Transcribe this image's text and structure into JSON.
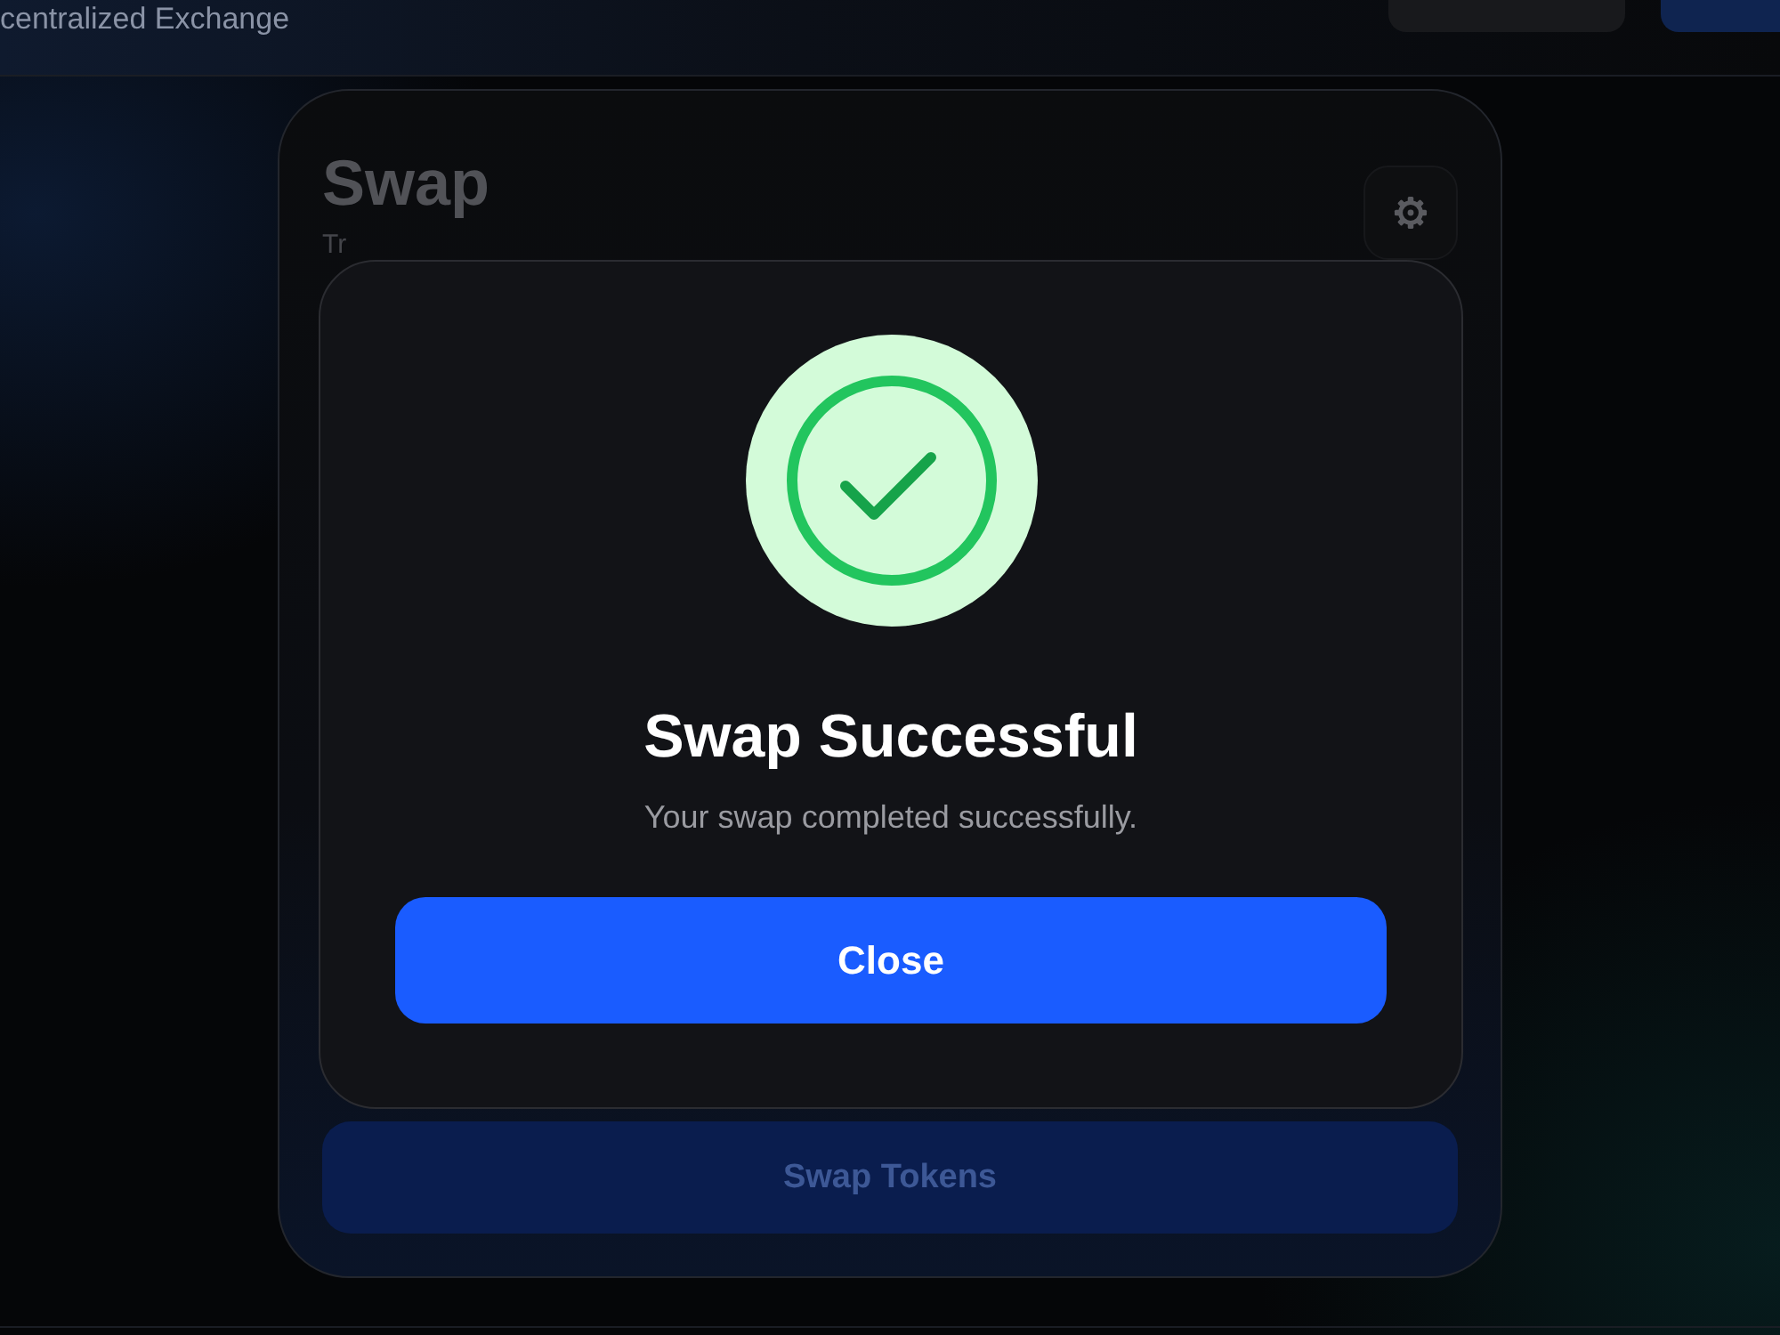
{
  "header": {
    "title": "centralized Exchange"
  },
  "swap_card": {
    "title": "Swap",
    "subtitle": "Tr",
    "action_button": "Swap Tokens"
  },
  "dialog": {
    "title": "Swap Successful",
    "message": "Your swap completed successfully.",
    "button": "Close"
  }
}
